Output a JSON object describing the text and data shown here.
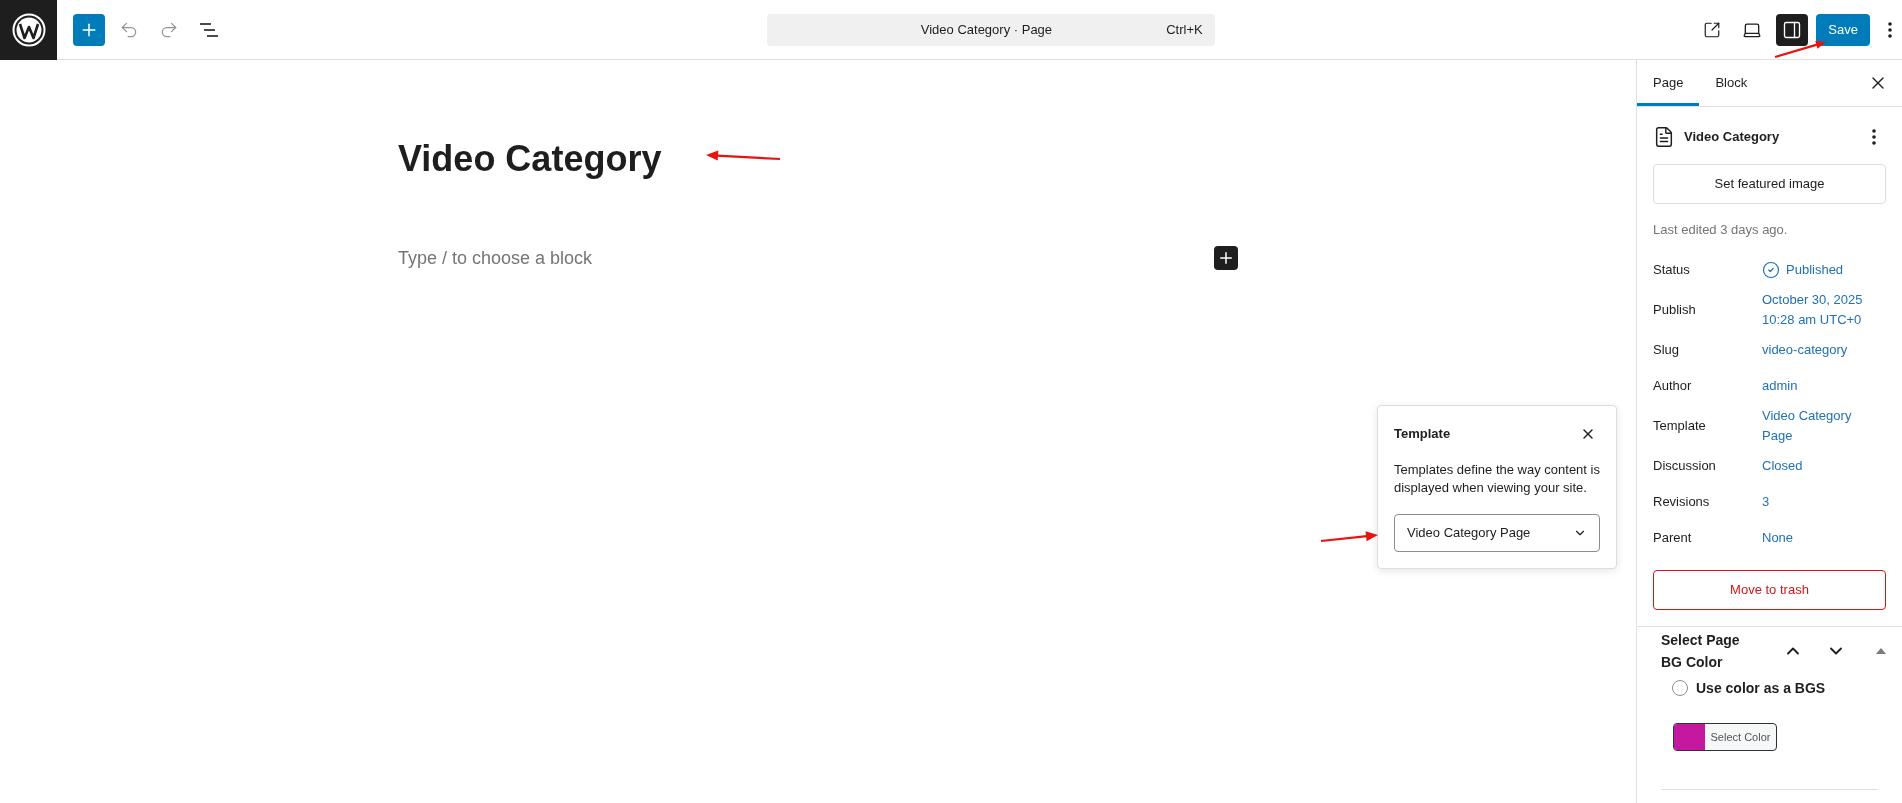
{
  "top_bar": {
    "undo": {
      "disabled": true
    },
    "redo": {
      "disabled": true
    },
    "command_bar": {
      "title": "Video Category · Page",
      "shortcut": "Ctrl+K"
    },
    "sidebar_toggle": {
      "pressed": true
    },
    "save_button": "Save"
  },
  "editor": {
    "title": "Video Category",
    "placeholder": "Type / to choose a block"
  },
  "template_popover": {
    "title": "Template",
    "description": "Templates define the way content is displayed when viewing your site.",
    "select": {
      "value": "Video Category Page"
    }
  },
  "sidebar": {
    "tabs": [
      {
        "label": "Page",
        "selected": true
      },
      {
        "label": "Block",
        "selected": false
      }
    ],
    "post_title": "Video Category",
    "featured_image_button": "Set featured image",
    "last_edited": "Last edited 3 days ago.",
    "fields": [
      {
        "label": "Status",
        "value": "Published",
        "kind": "status"
      },
      {
        "label": "Publish",
        "value": "October 30, 2025 10:28 am UTC+0",
        "kind": "link"
      },
      {
        "label": "Slug",
        "value": "video-category",
        "kind": "link"
      },
      {
        "label": "Author",
        "value": "admin",
        "kind": "link"
      },
      {
        "label": "Template",
        "value": "Video Category Page",
        "kind": "link"
      },
      {
        "label": "Discussion",
        "value": "Closed",
        "kind": "link"
      },
      {
        "label": "Revisions",
        "value": "3",
        "kind": "link"
      },
      {
        "label": "Parent",
        "value": "None",
        "kind": "link"
      }
    ],
    "trash_button": "Move to trash",
    "meta_box": {
      "title": "Select Page BG Color",
      "expanded": true,
      "radio": {
        "label": "Use color as a BGS",
        "checked": false
      },
      "color_picker": {
        "label": "Select Color",
        "color": "#c6189e"
      }
    }
  }
}
